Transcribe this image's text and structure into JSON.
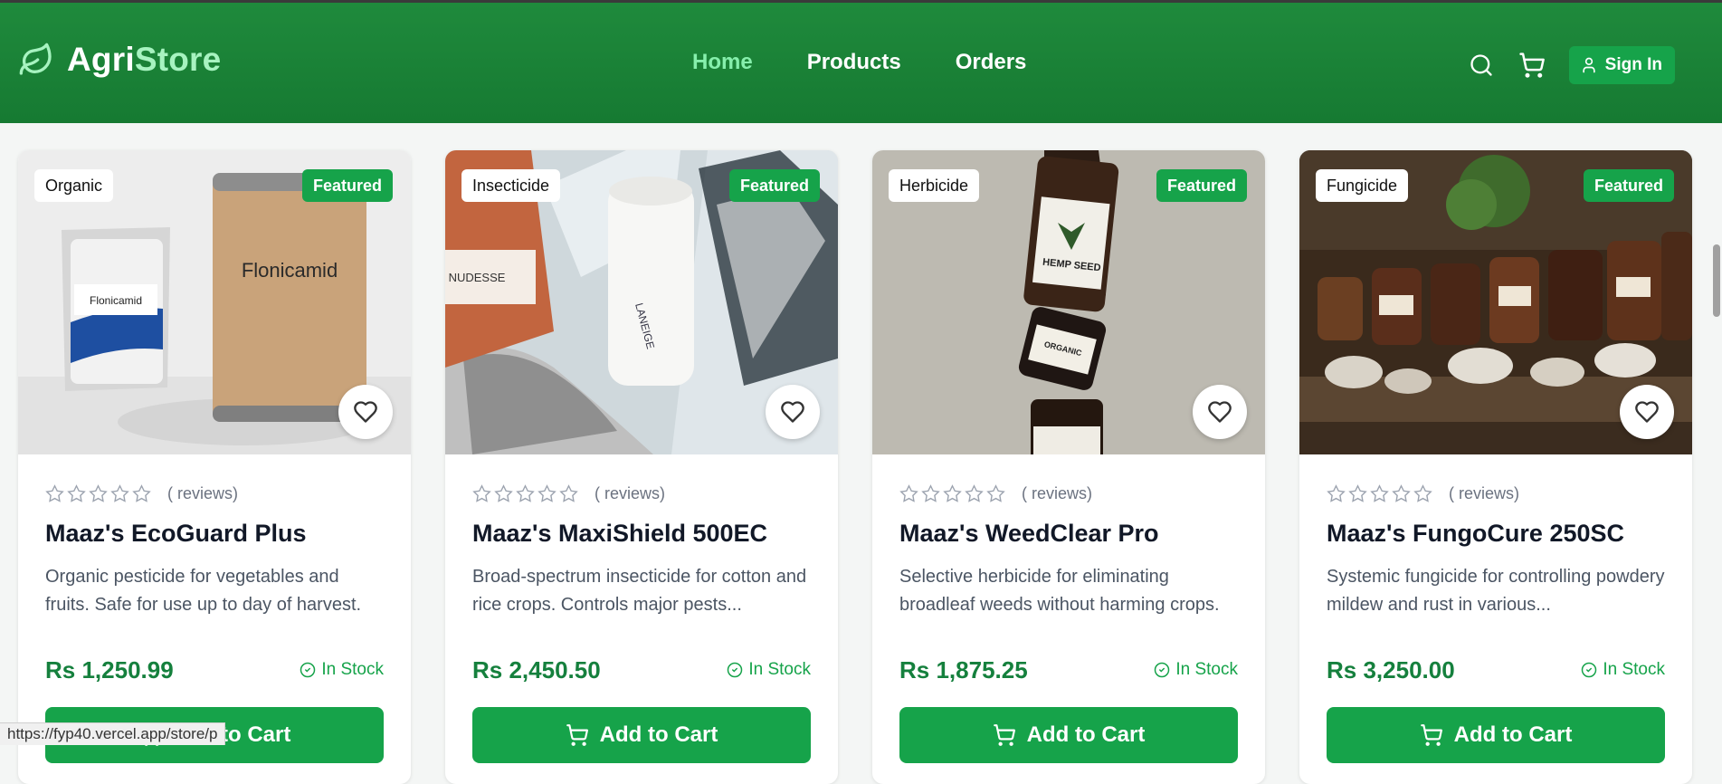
{
  "header": {
    "brand_part1": "Agri",
    "brand_part2": "Store",
    "nav": [
      {
        "label": "Home",
        "active": true
      },
      {
        "label": "Products",
        "active": false
      },
      {
        "label": "Orders",
        "active": false
      }
    ],
    "signin_label": "Sign In"
  },
  "products": [
    {
      "category": "Organic",
      "featured": "Featured",
      "reviews": "( reviews)",
      "name": "Maaz's EcoGuard Plus",
      "description": "Organic pesticide for vegetables and fruits. Safe for use up to day of harvest.",
      "price": "Rs 1,250.99",
      "stock": "In Stock",
      "cta": "Add to Cart",
      "image_text_1": "Flonicamid",
      "image_text_2": "Flonicamid"
    },
    {
      "category": "Insecticide",
      "featured": "Featured",
      "reviews": "( reviews)",
      "name": "Maaz's MaxiShield 500EC",
      "description": "Broad-spectrum insecticide for cotton and rice crops. Controls major pests...",
      "price": "Rs 2,450.50",
      "stock": "In Stock",
      "cta": "Add to Cart",
      "image_text_1": "NUDESSE",
      "image_text_2": "LANEIGE"
    },
    {
      "category": "Herbicide",
      "featured": "Featured",
      "reviews": "( reviews)",
      "name": "Maaz's WeedClear Pro",
      "description": "Selective herbicide for eliminating broadleaf weeds without harming crops.",
      "price": "Rs 1,875.25",
      "stock": "In Stock",
      "cta": "Add to Cart",
      "image_text_1": "HEMP SEED",
      "image_text_2": "ORGANIC"
    },
    {
      "category": "Fungicide",
      "featured": "Featured",
      "reviews": "( reviews)",
      "name": "Maaz's FungoCure 250SC",
      "description": "Systemic fungicide for controlling powdery mildew and rust in various...",
      "price": "Rs 3,250.00",
      "stock": "In Stock",
      "cta": "Add to Cart",
      "image_text_1": "",
      "image_text_2": ""
    }
  ],
  "statusbar": "https://fyp40.vercel.app/store/p",
  "colors": {
    "header": "#1a8538",
    "accent_green": "#16a34a",
    "price_green": "#15803d",
    "nav_active": "#86efac"
  }
}
